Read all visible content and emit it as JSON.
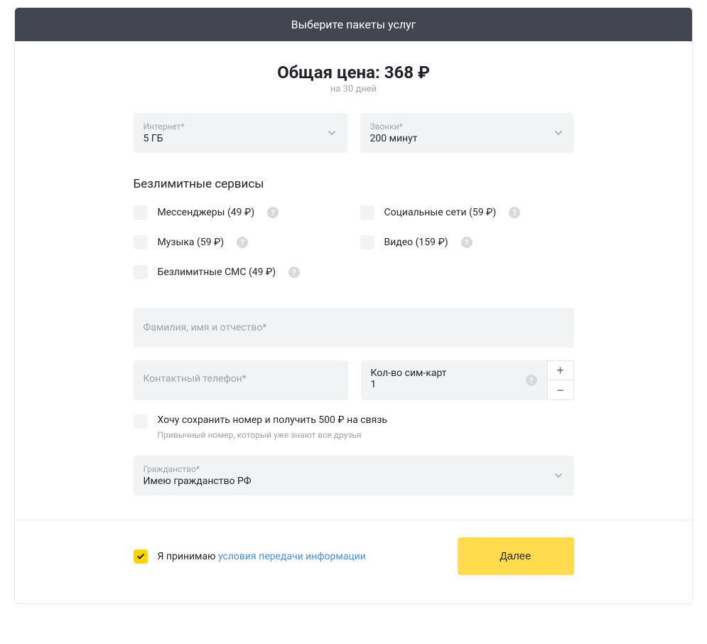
{
  "header": {
    "title": "Выберите пакеты услуг"
  },
  "price": {
    "label": "Общая цена: ",
    "amount": "368 ₽",
    "period": "на 30 дней"
  },
  "selects": {
    "internet": {
      "label": "Интернет*",
      "value": "5 ГБ"
    },
    "calls": {
      "label": "Звонки*",
      "value": "200 минут"
    }
  },
  "unlimited": {
    "title": "Безлимитные сервисы",
    "items": [
      {
        "name": "messengers",
        "label": "Мессенджеры (49 ₽)"
      },
      {
        "name": "social",
        "label": "Социальные сети (59 ₽)"
      },
      {
        "name": "music",
        "label": "Музыка (59 ₽)"
      },
      {
        "name": "video",
        "label": "Видео (159 ₽)"
      },
      {
        "name": "sms",
        "label": "Безлимитные СМС (49 ₽)"
      }
    ]
  },
  "form": {
    "fullname_placeholder": "Фамилия, имя и отчество*",
    "phone_placeholder": "Контактный телефон*",
    "sim": {
      "label": "Кол-во сим-карт",
      "value": "1"
    },
    "keep_number_label": "Хочу сохранить номер и получить 500 ₽ на связь",
    "keep_number_sub": "Привычный номер, который уже знают все друзья",
    "citizen": {
      "label": "Гражданство*",
      "value": "Имею гражданство РФ"
    }
  },
  "footer": {
    "accept_prefix": "Я принимаю ",
    "accept_link": "условия передачи информации",
    "next": "Далее"
  },
  "icons": {
    "help_glyph": "?"
  }
}
